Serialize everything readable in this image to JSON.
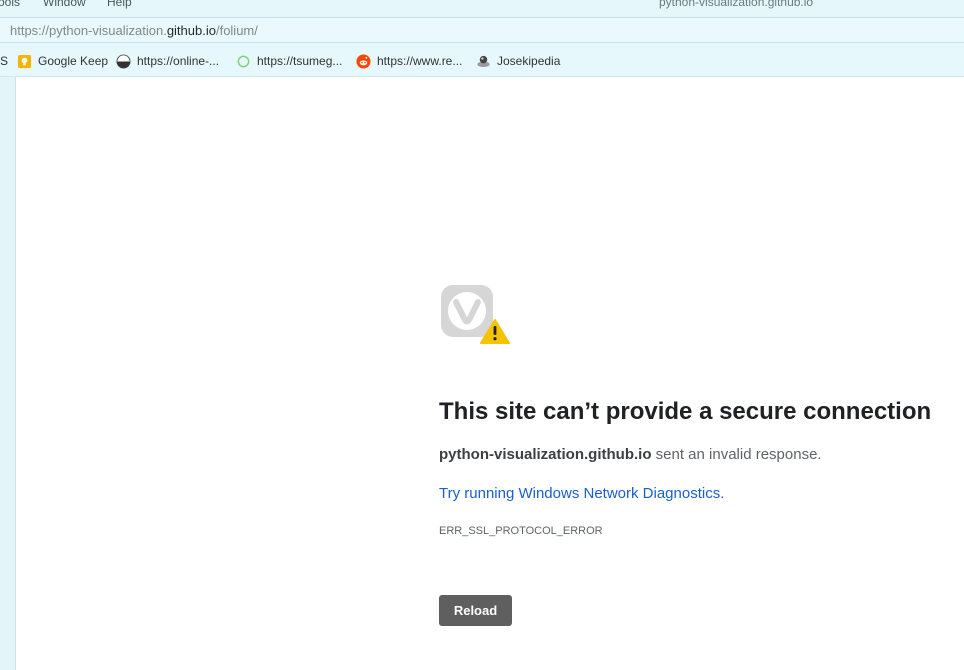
{
  "menubar": {
    "items": [
      "ools",
      "Window",
      "Help"
    ],
    "window_title": "python-visualization.github.io"
  },
  "address": {
    "prefix": "https://python-visualization.",
    "host": "github.io",
    "path": "/folium/"
  },
  "bookmarks": [
    {
      "label": "S",
      "icon": "cut-off-icon"
    },
    {
      "label": "Google Keep",
      "icon": "google-keep-icon",
      "color": "#f4b400"
    },
    {
      "label": "https://online-...",
      "icon": "online-go-icon"
    },
    {
      "label": "https://tsumeg...",
      "icon": "circle-icon",
      "color": "#7bd07b"
    },
    {
      "label": "https://www.re...",
      "icon": "reddit-icon",
      "color": "#ff4500"
    },
    {
      "label": "Josekipedia",
      "icon": "josekipedia-icon"
    }
  ],
  "error": {
    "icon": "vivaldi-warning-icon",
    "heading": "This site can’t provide a secure connection",
    "host": "python-visualization.github.io",
    "message": " sent an invalid response.",
    "link": "Try running Windows Network Diagnostics.",
    "code": "ERR_SSL_PROTOCOL_ERROR",
    "reload_label": "Reload",
    "warning_color": "#f5c400",
    "button_color": "#5f5f5f",
    "link_color": "#1a5fcc"
  }
}
